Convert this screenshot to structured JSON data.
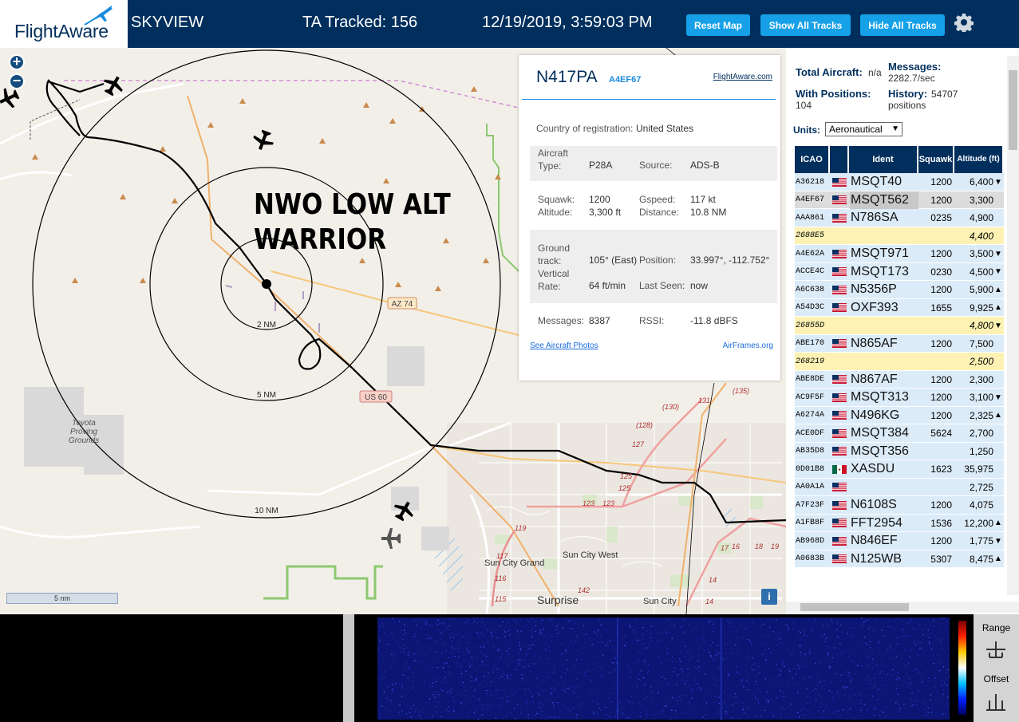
{
  "header": {
    "logo": "FlightAware",
    "app_title": "SKYVIEW",
    "tracked": "TA Tracked: 156",
    "datetime": "12/19/2019, 3:59:03 PM",
    "buttons": {
      "reset": "Reset Map",
      "show_all": "Show All Tracks",
      "hide_all": "Hide All Tracks"
    }
  },
  "map": {
    "zoom_in": "+",
    "zoom_out": "−",
    "overlay_text_line1": "NWO LOW ALT",
    "overlay_text_line2": "WARRIOR",
    "range_labels": [
      "2 NM",
      "5 NM",
      "10 NM"
    ],
    "road_labels": [
      "AZ 74",
      "US 60"
    ],
    "place_labels": [
      "Toyota",
      "Proving",
      "Grounds",
      "Sun City West",
      "Sun City Grand",
      "Surprise",
      "Sun City"
    ],
    "route_numbers": [
      "131",
      "(135)",
      "(130)",
      "(128)",
      "127",
      "125",
      "125",
      "123",
      "123",
      "119",
      "117",
      "116",
      "115",
      "142",
      "17",
      "16",
      "18",
      "19",
      "14",
      "14"
    ],
    "scale": "5 nm",
    "info_icon": "i"
  },
  "popup": {
    "registration": "N417PA",
    "hex": "A4EF67",
    "link_fa": "FlightAware.com",
    "country_label": "Country of registration:",
    "country_value": "United States",
    "aircraft_type_label": "Aircraft\nType:",
    "aircraft_type_value": "P28A",
    "source_label": "Source:",
    "source_value": "ADS-B",
    "squawk_label": "Squawk:",
    "squawk_value": "1200",
    "altitude_label": "Altitude:",
    "altitude_value": "3,300 ft",
    "gspeed_label": "Gspeed:",
    "gspeed_value": "117 kt",
    "distance_label": "Distance:",
    "distance_value": "10.8 NM",
    "ground_track_label": "Ground\ntrack:",
    "ground_track_value": "105° (East)",
    "position_label": "Position:",
    "position_value": "33.997°, -112.752°",
    "vrate_label": "Vertical\nRate:",
    "vrate_value": "64 ft/min",
    "last_seen_label": "Last Seen:",
    "last_seen_value": "now",
    "messages_label": "Messages:",
    "messages_value": "8387",
    "rssi_label": "RSSI:",
    "rssi_value": "-11.8 dBFS",
    "link_photos": "See Aircraft Photos",
    "link_airframes": "AirFrames.org"
  },
  "panel": {
    "total_aircraft_label": "Total Aircraft:",
    "total_aircraft_value": "n/a",
    "messages_label": "Messages:",
    "messages_value": "2282.7/sec",
    "with_positions_label": "With Positions:",
    "with_positions_value": "104",
    "history_label": "History:",
    "history_value": "54707",
    "history_unit": "positions",
    "units_label": "Units:",
    "units_value": "Aeronautical",
    "columns": [
      "ICAO",
      "Ident",
      "Squawk",
      "Altitude (ft)"
    ],
    "rows": [
      {
        "icao": "A36218",
        "flag": "us",
        "ident": "MSQT40",
        "squawk": "1200",
        "alt": "6,400",
        "trend": "▼",
        "style": "normal"
      },
      {
        "icao": "A4EF67",
        "flag": "us",
        "ident": "MSQT562",
        "squawk": "1200",
        "alt": "3,300",
        "trend": "",
        "style": "selected"
      },
      {
        "icao": "AAA861",
        "flag": "us",
        "ident": "N786SA",
        "squawk": "0235",
        "alt": "4,900",
        "trend": "",
        "style": "normal"
      },
      {
        "icao": "2688E5",
        "flag": "",
        "ident": "",
        "squawk": "",
        "alt": "4,400",
        "trend": "",
        "style": "mlat"
      },
      {
        "icao": "A4E62A",
        "flag": "us",
        "ident": "MSQT971",
        "squawk": "1200",
        "alt": "3,500",
        "trend": "▼",
        "style": "normal"
      },
      {
        "icao": "ACCE4C",
        "flag": "us",
        "ident": "MSQT173",
        "squawk": "0230",
        "alt": "4,500",
        "trend": "▼",
        "style": "normal"
      },
      {
        "icao": "A6C638",
        "flag": "us",
        "ident": "N5356P",
        "squawk": "1200",
        "alt": "5,900",
        "trend": "▲",
        "style": "normal"
      },
      {
        "icao": "A54D3C",
        "flag": "us",
        "ident": "OXF393",
        "squawk": "1655",
        "alt": "9,925",
        "trend": "▲",
        "style": "normal"
      },
      {
        "icao": "26855D",
        "flag": "",
        "ident": "",
        "squawk": "",
        "alt": "4,800",
        "trend": "▼",
        "style": "mlat"
      },
      {
        "icao": "ABE170",
        "flag": "us",
        "ident": "N865AF",
        "squawk": "1200",
        "alt": "7,500",
        "trend": "",
        "style": "normal"
      },
      {
        "icao": "268219",
        "flag": "",
        "ident": "",
        "squawk": "",
        "alt": "2,500",
        "trend": "",
        "style": "mlat"
      },
      {
        "icao": "ABE8DE",
        "flag": "us",
        "ident": "N867AF",
        "squawk": "1200",
        "alt": "2,300",
        "trend": "",
        "style": "normal"
      },
      {
        "icao": "AC9F5F",
        "flag": "us",
        "ident": "MSQT313",
        "squawk": "1200",
        "alt": "3,100",
        "trend": "▼",
        "style": "normal"
      },
      {
        "icao": "A6274A",
        "flag": "us",
        "ident": "N496KG",
        "squawk": "1200",
        "alt": "2,325",
        "trend": "▲",
        "style": "normal"
      },
      {
        "icao": "ACE0DF",
        "flag": "us",
        "ident": "MSQT384",
        "squawk": "5624",
        "alt": "2,700",
        "trend": "",
        "style": "normal"
      },
      {
        "icao": "AB35D8",
        "flag": "us",
        "ident": "MSQT356",
        "squawk": "",
        "alt": "1,250",
        "trend": "",
        "style": "normal"
      },
      {
        "icao": "0D01B8",
        "flag": "mx",
        "ident": "XASDU",
        "squawk": "1623",
        "alt": "35,975",
        "trend": "",
        "style": "normal"
      },
      {
        "icao": "AA0A1A",
        "flag": "us",
        "ident": "",
        "squawk": "",
        "alt": "2,725",
        "trend": "",
        "style": "normal"
      },
      {
        "icao": "A7F23F",
        "flag": "us",
        "ident": "N6108S",
        "squawk": "1200",
        "alt": "4,075",
        "trend": "",
        "style": "normal"
      },
      {
        "icao": "A1FB8F",
        "flag": "us",
        "ident": "FFT2954",
        "squawk": "1536",
        "alt": "12,200",
        "trend": "▲",
        "style": "normal"
      },
      {
        "icao": "AB968D",
        "flag": "us",
        "ident": "N846EF",
        "squawk": "1200",
        "alt": "1,775",
        "trend": "▼",
        "style": "normal"
      },
      {
        "icao": "A0683B",
        "flag": "us",
        "ident": "N125WB",
        "squawk": "5307",
        "alt": "8,475",
        "trend": "▲",
        "style": "normal"
      }
    ]
  },
  "waterfall": {
    "range_label": "Range",
    "offset_label": "Offset"
  },
  "colors": {
    "header_bg": "#002f5d",
    "button_blue": "#15a0e8",
    "row_normal": "#dcebf8",
    "row_selected": "#dcdcdc",
    "row_mlat": "#fdf2b3"
  }
}
